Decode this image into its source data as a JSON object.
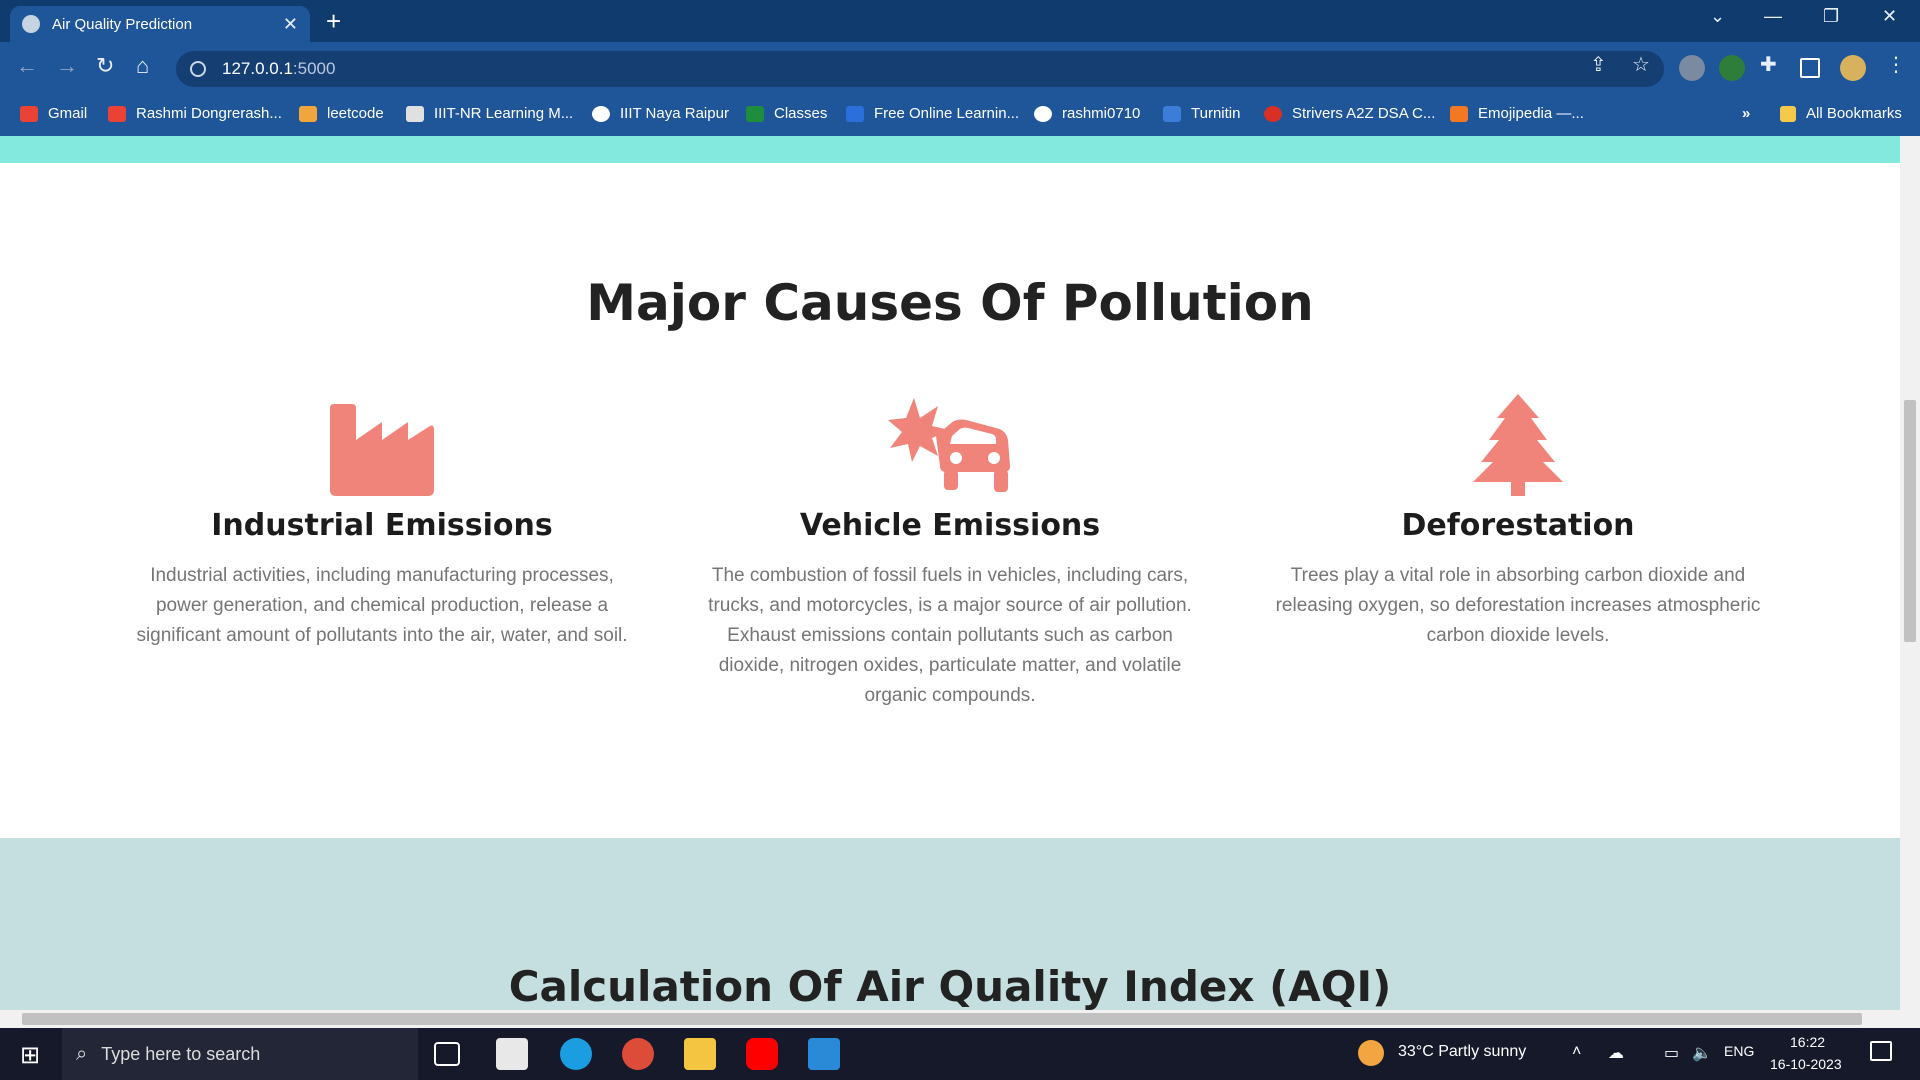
{
  "browser": {
    "tab_title": "Air Quality Prediction",
    "new_tab": "+",
    "url_host": "127.0.0.1",
    "url_port": ":5000",
    "controls": {
      "minimize": "—",
      "maximize": "❐",
      "close": "✕",
      "tab_search": "⌄"
    }
  },
  "bookmarks": [
    {
      "label": "Gmail",
      "color": "#ea4335"
    },
    {
      "label": "Rashmi Dongrerash...",
      "color": "#ea4335"
    },
    {
      "label": "leetcode",
      "color": "#f0a63c"
    },
    {
      "label": "IIIT-NR Learning M...",
      "color": "#e0e0e0"
    },
    {
      "label": "IIIT Naya Raipur",
      "color": "#ffffff"
    },
    {
      "label": "Classes",
      "color": "#1e8e3e"
    },
    {
      "label": "Free Online Learnin...",
      "color": "#2a6fdb"
    },
    {
      "label": "rashmi0710",
      "color": "#ffffff"
    },
    {
      "label": "Turnitin",
      "color": "#3c7dd9"
    },
    {
      "label": "Strivers A2Z DSA C...",
      "color": "#d93025"
    },
    {
      "label": "Emojipedia —...",
      "color": "#f27822"
    }
  ],
  "bookmarks_more": "»",
  "all_bookmarks": "All Bookmarks",
  "page": {
    "section_title": "Major Causes Of Pollution",
    "accent_color": "#f0847a",
    "causes": [
      {
        "icon": "industry-icon",
        "title": "Industrial Emissions",
        "text": "Industrial activities, including manufacturing processes, power generation, and chemical production, release a significant amount of pollutants into the air, water, and soil."
      },
      {
        "icon": "car-burst-icon",
        "title": "Vehicle Emissions",
        "text": "The combustion of fossil fuels in vehicles, including cars, trucks, and motorcycles, is a major source of air pollution. Exhaust emissions contain pollutants such as carbon dioxide, nitrogen oxides, particulate matter, and volatile organic compounds."
      },
      {
        "icon": "tree-icon",
        "title": "Deforestation",
        "text": "Trees play a vital role in absorbing carbon dioxide and releasing oxygen, so deforestation increases atmospheric carbon dioxide levels."
      }
    ],
    "aqi_title": "Calculation Of Air Quality Index (AQI)"
  },
  "taskbar": {
    "search_placeholder": "Type here to search",
    "weather": "33°C  Partly sunny",
    "language": "ENG",
    "time": "16:22",
    "date": "16-10-2023"
  }
}
